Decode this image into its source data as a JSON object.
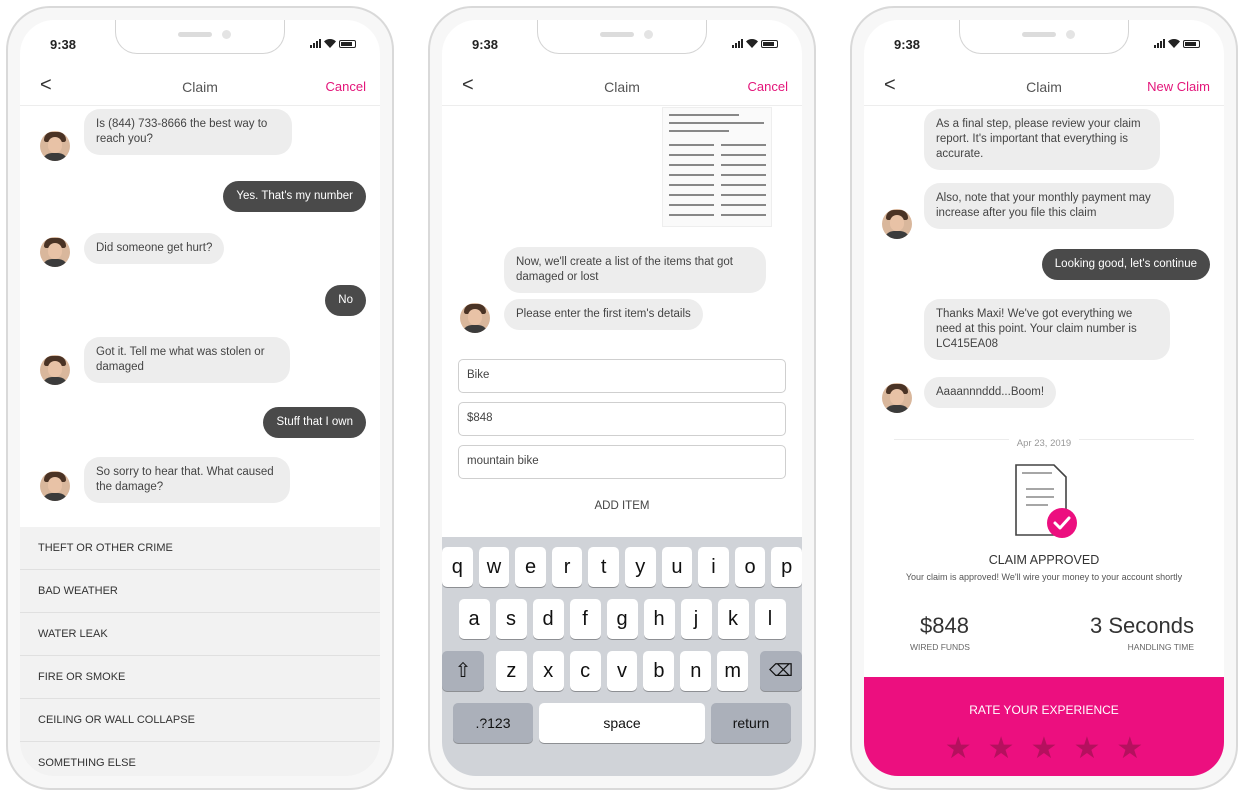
{
  "phones": [
    {
      "status_time": "9:38",
      "nav": {
        "back": "<",
        "title": "Claim",
        "action": "Cancel"
      },
      "messages": [
        {
          "from": "agent",
          "text": "Is (844) 733-8666 the best way to reach you?"
        },
        {
          "from": "user",
          "text": "Yes. That's my number"
        },
        {
          "from": "agent",
          "text": "Did someone get hurt?"
        },
        {
          "from": "user",
          "text": "No"
        },
        {
          "from": "agent",
          "text": "Got it. Tell me what was stolen or damaged"
        },
        {
          "from": "user",
          "text": "Stuff that I own"
        },
        {
          "from": "agent",
          "text": "So sorry to hear that. What caused the damage?"
        }
      ],
      "options": [
        "THEFT OR OTHER CRIME",
        "BAD WEATHER",
        "WATER LEAK",
        "FIRE OR SMOKE",
        "CEILING OR WALL COLLAPSE",
        "SOMETHING ELSE"
      ]
    },
    {
      "status_time": "9:38",
      "nav": {
        "back": "<",
        "title": "Claim",
        "action": "Cancel"
      },
      "messages": [
        {
          "from": "agent",
          "text": "Now, we'll create a list of the items that got damaged or lost"
        },
        {
          "from": "agent",
          "text": "Please enter the first item's details"
        }
      ],
      "fields": [
        "Bike",
        "$848",
        "mountain bike"
      ],
      "add_item": "ADD ITEM",
      "keyboard": {
        "row1": [
          "q",
          "w",
          "e",
          "r",
          "t",
          "y",
          "u",
          "i",
          "o",
          "p"
        ],
        "row2": [
          "a",
          "s",
          "d",
          "f",
          "g",
          "h",
          "j",
          "k",
          "l"
        ],
        "row3": [
          "z",
          "x",
          "c",
          "v",
          "b",
          "n",
          "m"
        ],
        "shift": "⇧",
        "delete": "⌫",
        "numbers": ".?123",
        "space": "space",
        "return": "return"
      }
    },
    {
      "status_time": "9:38",
      "nav": {
        "back": "<",
        "title": "Claim",
        "action": "New Claim"
      },
      "messages": [
        {
          "from": "agent",
          "text": "As a final step, please review your claim report. It's important that everything is accurate."
        },
        {
          "from": "agent",
          "text": "Also, note that your monthly payment may increase after you file this claim"
        },
        {
          "from": "user",
          "text": "Looking good, let's continue"
        },
        {
          "from": "agent",
          "text": "Thanks Maxi! We've got everything we need at this point. Your claim number is LC415EA08"
        },
        {
          "from": "agent",
          "text": "Aaaannnddd...Boom!"
        }
      ],
      "date": "Apr 23, 2019",
      "approved": {
        "title": "CLAIM APPROVED",
        "text": "Your claim is approved! We'll wire your money to your account shortly",
        "amount": "$848",
        "amount_label": "WIRED FUNDS",
        "time": "3 Seconds",
        "time_label": "HANDLING TIME"
      },
      "rate": {
        "label": "RATE YOUR EXPERIENCE",
        "stars": 5
      }
    }
  ],
  "colors": {
    "accent": "#e3157a",
    "rate_bg": "#ec0f7f",
    "star": "#b5105e",
    "user_bubble": "#4a4a4a"
  }
}
